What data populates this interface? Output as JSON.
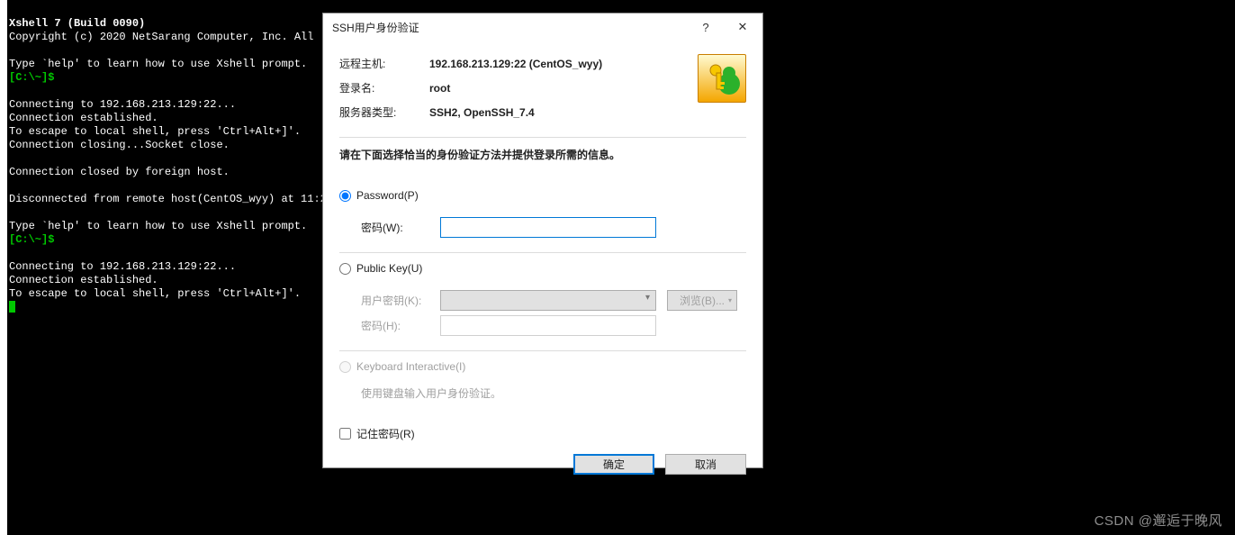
{
  "terminal": {
    "title": "Xshell 7 (Build 0090)",
    "copyright": "Copyright (c) 2020 NetSarang Computer, Inc. All ",
    "help_hint": "Type `help' to learn how to use Xshell prompt.",
    "prompt": "[C:\\~]$ ",
    "line_connecting": "Connecting to 192.168.213.129:22...",
    "line_established": "Connection established.",
    "line_escape": "To escape to local shell, press 'Ctrl+Alt+]'.",
    "line_closing": "Connection closing...Socket close.",
    "line_closed": "Connection closed by foreign host.",
    "line_disconnected": "Disconnected from remote host(CentOS_wyy) at 11:2"
  },
  "dialog": {
    "title": "SSH用户身份验证",
    "help_glyph": "?",
    "close_glyph": "✕",
    "labels": {
      "remote_host": "远程主机:",
      "login_name": "登录名:",
      "server_type": "服务器类型:"
    },
    "values": {
      "remote_host": "192.168.213.129:22 (CentOS_wyy)",
      "login_name": "root",
      "server_type": "SSH2, OpenSSH_7.4"
    },
    "instruction": "请在下面选择恰当的身份验证方法并提供登录所需的信息。",
    "password_radio": "Password(P)",
    "password_label": "密码(W):",
    "publickey_radio": "Public Key(U)",
    "userkey_label": "用户密钥(K):",
    "passphrase_label": "密码(H):",
    "browse_btn": "浏览(B)...",
    "keyboard_radio": "Keyboard Interactive(I)",
    "keyboard_note": "使用键盘输入用户身份验证。",
    "remember": "记住密码(R)",
    "ok_btn": "确定",
    "cancel_btn": "取消"
  },
  "watermark": "CSDN @邂逅于晚风"
}
